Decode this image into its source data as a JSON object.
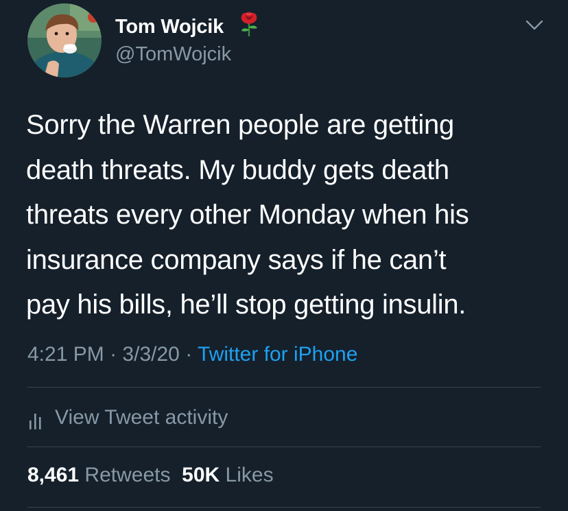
{
  "header": {
    "display_name": "Tom Wojcik",
    "handle": "@TomWojcik",
    "name_emoji": "rose-emoji",
    "menu_icon": "chevron-down-icon"
  },
  "tweet": {
    "lines": [
      "Sorry the Warren people are getting",
      "death threats. My buddy gets death",
      "threats every other Monday when his",
      "insurance company says if he can’t",
      "pay his bills, he’ll stop getting insulin."
    ]
  },
  "meta": {
    "time": "4:21 PM",
    "separator": "·",
    "date": "3/3/20",
    "source": "Twitter for iPhone"
  },
  "activity": {
    "label": "View Tweet activity",
    "icon": "bar-chart-icon"
  },
  "stats": {
    "retweets_count": "8,461",
    "retweets_label": "Retweets",
    "likes_count": "50K",
    "likes_label": "Likes"
  },
  "colors": {
    "background": "#15202b",
    "primary_text": "#ffffff",
    "secondary_text": "#8899a6",
    "link": "#1da1f2",
    "divider": "#38444d"
  }
}
